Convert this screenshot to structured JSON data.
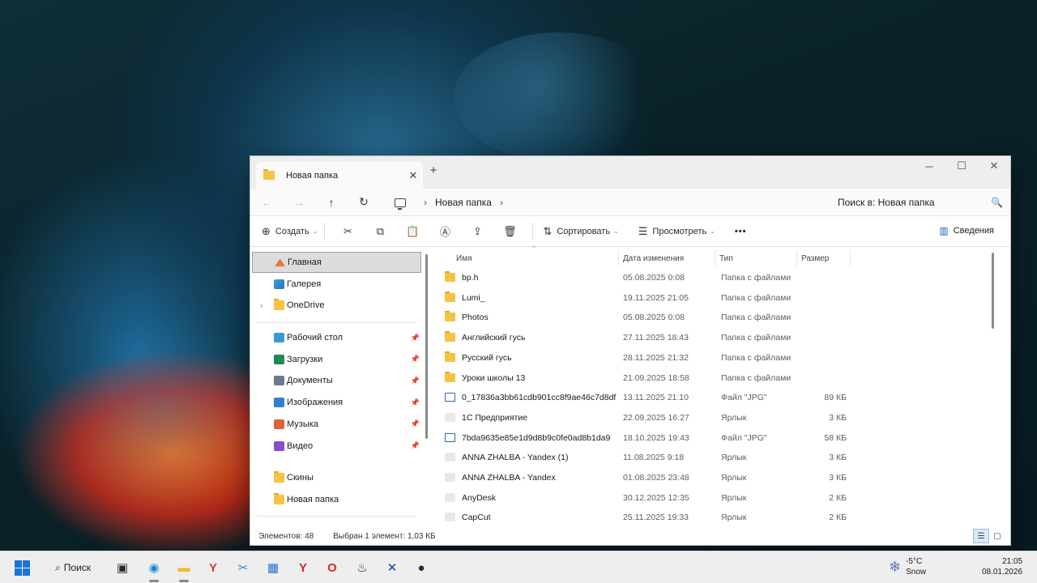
{
  "window": {
    "tab_title": "Новая папка",
    "tab_close": "✕",
    "new_tab": "+",
    "controls": {
      "minimize": "─",
      "maximize": "☐",
      "close": "✕"
    }
  },
  "address": {
    "back": "←",
    "forward": "→",
    "up": "↑",
    "refresh": "↻",
    "separator": "›",
    "crumb": "Новая папка",
    "search_placeholder": "Поиск в: Новая папка",
    "search_icon": "🔍"
  },
  "toolbar": {
    "create": "Создать",
    "sort": "Сортировать",
    "view": "Просмотреть",
    "more": "•••",
    "details": "Сведения",
    "icons": {
      "create": "⊕",
      "cut": "✂",
      "copy": "⧉",
      "paste": "📋",
      "rename": "Ⓐ",
      "share": "⇪",
      "delete": "🗑",
      "sort": "⇅",
      "view": "☰",
      "details": "▥"
    }
  },
  "nav": {
    "home": "Главная",
    "gallery": "Галерея",
    "onedrive": "OneDrive",
    "expand": "›",
    "pin": "📌",
    "pinned": [
      {
        "label": "Рабочий стол",
        "icon": "desktop-icon",
        "color": "#3a9ad9"
      },
      {
        "label": "Загрузки",
        "icon": "download-icon",
        "color": "#1f8a55"
      },
      {
        "label": "Документы",
        "icon": "documents-icon",
        "color": "#6b7c8f"
      },
      {
        "label": "Изображения",
        "icon": "pictures-icon",
        "color": "#2e7fcf"
      },
      {
        "label": "Музыка",
        "icon": "music-icon",
        "color": "#e0623a"
      },
      {
        "label": "Видео",
        "icon": "video-icon",
        "color": "#8b4bcf"
      }
    ],
    "folders": [
      "Скины",
      "Новая папка"
    ]
  },
  "columns": {
    "name": "Имя",
    "date": "Дата изменения",
    "type": "Тип",
    "size": "Размер",
    "sort_caret": "^"
  },
  "files": [
    {
      "name": "bp.h",
      "date": "05.08.2025 0:08",
      "type": "Папка с файлами",
      "size": "",
      "kind": "folder"
    },
    {
      "name": "Lumi_",
      "date": "19.11.2025 21:05",
      "type": "Папка с файлами",
      "size": "",
      "kind": "folder"
    },
    {
      "name": "Photos",
      "date": "05.08.2025 0:08",
      "type": "Папка с файлами",
      "size": "",
      "kind": "folder"
    },
    {
      "name": "Английский гусь",
      "date": "27.11.2025 18:43",
      "type": "Папка с файлами",
      "size": "",
      "kind": "folder"
    },
    {
      "name": "Русский гусь",
      "date": "28.11.2025 21:32",
      "type": "Папка с файлами",
      "size": "",
      "kind": "folder"
    },
    {
      "name": "Уроки школы 13",
      "date": "21.09.2025 18:58",
      "type": "Папка с файлами",
      "size": "",
      "kind": "folder"
    },
    {
      "name": "0_17836a3bb61cdb901cc8f9ae46c7d8df",
      "date": "13.11.2025 21:10",
      "type": "Файл \"JPG\"",
      "size": "89 КБ",
      "kind": "file"
    },
    {
      "name": "1С Предприятие",
      "date": "22.09.2025 16:27",
      "type": "Ярлык",
      "size": "3 КБ",
      "kind": "link"
    },
    {
      "name": "7bda9635e85e1d9d8b9c0fe0ad8b1da9",
      "date": "18.10.2025 19:43",
      "type": "Файл \"JPG\"",
      "size": "58 КБ",
      "kind": "file"
    },
    {
      "name": "ANNA ZHALBA - Yandex (1)",
      "date": "11.08.2025 9:18",
      "type": "Ярлык",
      "size": "3 КБ",
      "kind": "link"
    },
    {
      "name": "ANNA ZHALBA - Yandex",
      "date": "01.08.2025 23:48",
      "type": "Ярлык",
      "size": "3 КБ",
      "kind": "link"
    },
    {
      "name": "AnyDesk",
      "date": "30.12.2025 12:35",
      "type": "Ярлык",
      "size": "2 КБ",
      "kind": "link"
    },
    {
      "name": "CapCut",
      "date": "25.11.2025 19:33",
      "type": "Ярлык",
      "size": "2 КБ",
      "kind": "link"
    }
  ],
  "status": {
    "count": "Элементов: 48",
    "selection": "Выбран 1 элемент: 1,03 КБ",
    "view_details_icon": "☰",
    "view_tiles_icon": "▢"
  },
  "taskbar": {
    "search_label": "Поиск",
    "search_icon": "⌕",
    "weather_temp": "-5°C",
    "weather_desc": "Snow",
    "weather_icon": "❄",
    "time": "21:05",
    "date": "08.01.2026",
    "apps": [
      {
        "name": "task-view-icon",
        "glyph": "▣",
        "color": "#2b2b2b"
      },
      {
        "name": "edge-icon",
        "glyph": "◉",
        "color": "#1b8ad3"
      },
      {
        "name": "file-explorer-icon",
        "glyph": "▬",
        "color": "#f2b834"
      },
      {
        "name": "yandex-icon",
        "glyph": "Y",
        "color": "#e03a2f"
      },
      {
        "name": "snipping-icon",
        "glyph": "✂",
        "color": "#2a8bd8"
      },
      {
        "name": "store-icon",
        "glyph": "▦",
        "color": "#2a6fd0"
      },
      {
        "name": "yandex-browser-icon",
        "glyph": "Y",
        "color": "#d8232a"
      },
      {
        "name": "opera-icon",
        "glyph": "O",
        "color": "#e0262d"
      },
      {
        "name": "steam-icon",
        "glyph": "♨",
        "color": "#1b2838"
      },
      {
        "name": "xbox-icon",
        "glyph": "✕",
        "color": "#1a3fb0"
      },
      {
        "name": "obs-icon",
        "glyph": "●",
        "color": "#2b2b2b"
      }
    ]
  }
}
